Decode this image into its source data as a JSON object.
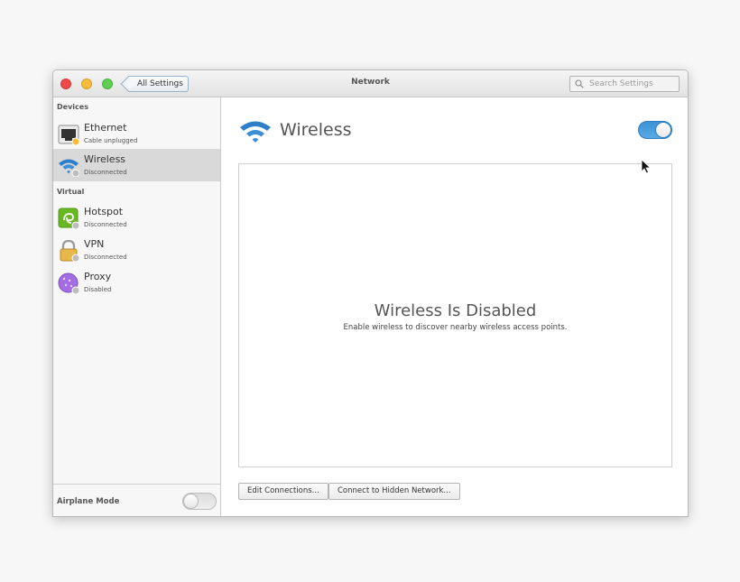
{
  "window": {
    "title": "Network",
    "back_label": "All Settings",
    "search_placeholder": "Search Settings"
  },
  "sidebar": {
    "sections": [
      {
        "label": "Devices",
        "items": [
          {
            "name": "Ethernet",
            "status": "Cable unplugged",
            "icon": "ethernet-icon",
            "badge_color": "#f5bb3b",
            "selected": false
          },
          {
            "name": "Wireless",
            "status": "Disconnected",
            "icon": "wireless-icon",
            "badge_color": "#bdbdbd",
            "selected": true
          }
        ]
      },
      {
        "label": "Virtual",
        "items": [
          {
            "name": "Hotspot",
            "status": "Disconnected",
            "icon": "hotspot-icon",
            "badge_color": "#bdbdbd",
            "selected": false
          },
          {
            "name": "VPN",
            "status": "Disconnected",
            "icon": "lock-icon",
            "badge_color": "#bdbdbd",
            "selected": false
          },
          {
            "name": "Proxy",
            "status": "Disabled",
            "icon": "proxy-globe-icon",
            "badge_color": "#bdbdbd",
            "selected": false
          }
        ]
      }
    ],
    "airplane_mode": {
      "label": "Airplane Mode",
      "enabled": false
    }
  },
  "main": {
    "title": "Wireless",
    "wireless_enabled": true,
    "empty_title": "Wireless Is Disabled",
    "empty_subtitle": "Enable wireless to discover nearby wireless access points.",
    "buttons": {
      "edit_connections": "Edit Connections...",
      "connect_hidden": "Connect to Hidden Network..."
    }
  },
  "colors": {
    "accent": "#3689e6",
    "selection": "#d9d9d9",
    "close": "#ed4a4a",
    "minimize": "#f5bb3b",
    "maximize": "#5ecf52"
  }
}
